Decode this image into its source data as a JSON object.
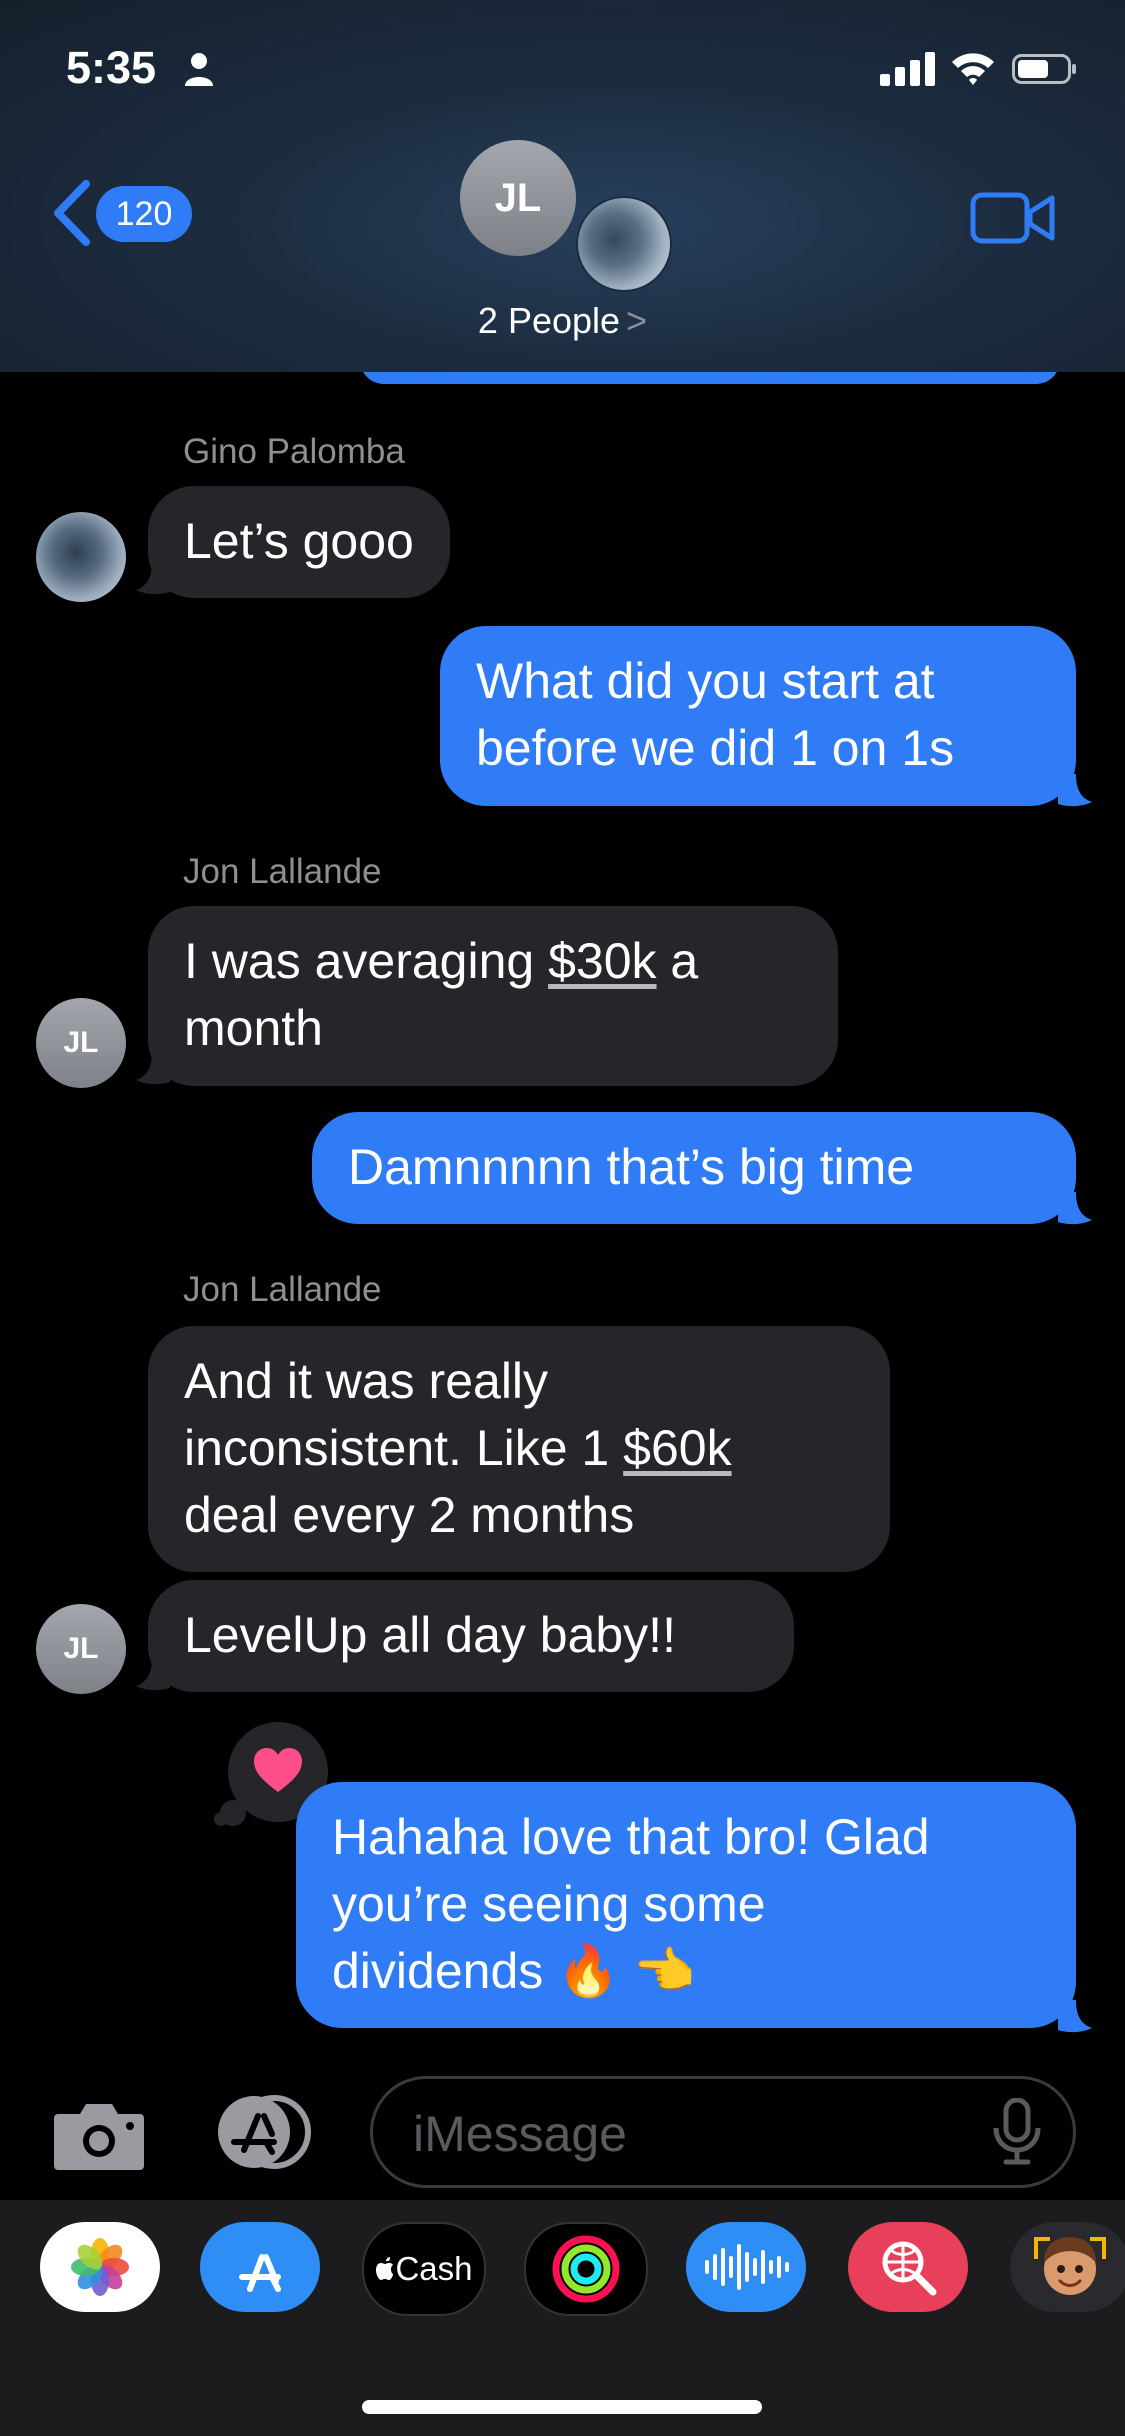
{
  "status_bar": {
    "time": "5:35"
  },
  "nav": {
    "back_count": "120",
    "group_initials": "JL",
    "people_label": "2 People",
    "people_chevron": ">"
  },
  "messages": [
    {
      "sender": "Gino Palomba",
      "text": "Let’s gooo"
    },
    {
      "text_line1": "What did you start at",
      "text_line2": "before we did 1 on 1s"
    },
    {
      "sender": "Jon Lallande",
      "pre": "I was averaging ",
      "link": "$30k",
      "post": " a",
      "line2": "month",
      "avatar": "JL"
    },
    {
      "text": "Damnnnnn that’s big time"
    },
    {
      "sender": "Jon Lallande",
      "line1": "And it was really",
      "line2_pre": "inconsistent. Like 1 ",
      "link": "$60k",
      "line3": "deal every 2 months"
    },
    {
      "text": "LevelUp all day baby!!",
      "avatar": "JL"
    },
    {
      "line1": "Hahaha love that bro! Glad",
      "line2": "you’re seeing some",
      "line3": "dividends 🔥 👈",
      "tapback": "heart-icon"
    }
  ],
  "composer": {
    "placeholder": "iMessage"
  },
  "drawer": {
    "cash_label": "Cash"
  },
  "colors": {
    "outgoing": "#2f7cf6",
    "incoming": "#26262a",
    "background": "#000000"
  }
}
